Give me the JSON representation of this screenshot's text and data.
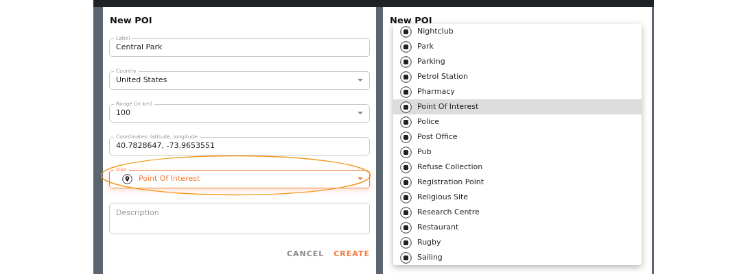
{
  "form_view": {
    "title": "New POI",
    "fields": [
      {
        "kind": "text",
        "label": "Label",
        "value": "Central Park",
        "focused": false,
        "highlighted": false
      },
      {
        "kind": "select",
        "label": "Country",
        "value": "United States",
        "focused": false,
        "highlighted": false
      },
      {
        "kind": "select",
        "label": "Range (in km)",
        "value": "100",
        "focused": false,
        "highlighted": false
      },
      {
        "kind": "text",
        "label": "Coordinates: latitude, longitude",
        "value": "40.7828647, -73.9653551",
        "focused": false,
        "highlighted": false
      },
      {
        "kind": "icon-select",
        "label": "Icon",
        "value": "Point Of Interest",
        "focused": true,
        "highlighted": true
      },
      {
        "kind": "textarea",
        "placeholder": "Description",
        "focused": false,
        "highlighted": false
      }
    ],
    "buttons": [
      {
        "label": "CANCEL",
        "primary": false
      },
      {
        "label": "CREATE",
        "primary": true
      }
    ]
  },
  "menu_view": {
    "title": "New POI",
    "menu": [
      {
        "label": "Nightclub",
        "selected": false
      },
      {
        "label": "Park",
        "selected": false
      },
      {
        "label": "Parking",
        "selected": false
      },
      {
        "label": "Petrol Station",
        "selected": false
      },
      {
        "label": "Pharmacy",
        "selected": false
      },
      {
        "label": "Point Of Interest",
        "selected": true
      },
      {
        "label": "Police",
        "selected": false
      },
      {
        "label": "Post Office",
        "selected": false
      },
      {
        "label": "Pub",
        "selected": false
      },
      {
        "label": "Refuse Collection",
        "selected": false
      },
      {
        "label": "Registration Point",
        "selected": false
      },
      {
        "label": "Religious Site",
        "selected": false
      },
      {
        "label": "Research Centre",
        "selected": false
      },
      {
        "label": "Restaurant",
        "selected": false
      },
      {
        "label": "Rugby",
        "selected": false
      },
      {
        "label": "Sailing",
        "selected": false
      }
    ]
  }
}
